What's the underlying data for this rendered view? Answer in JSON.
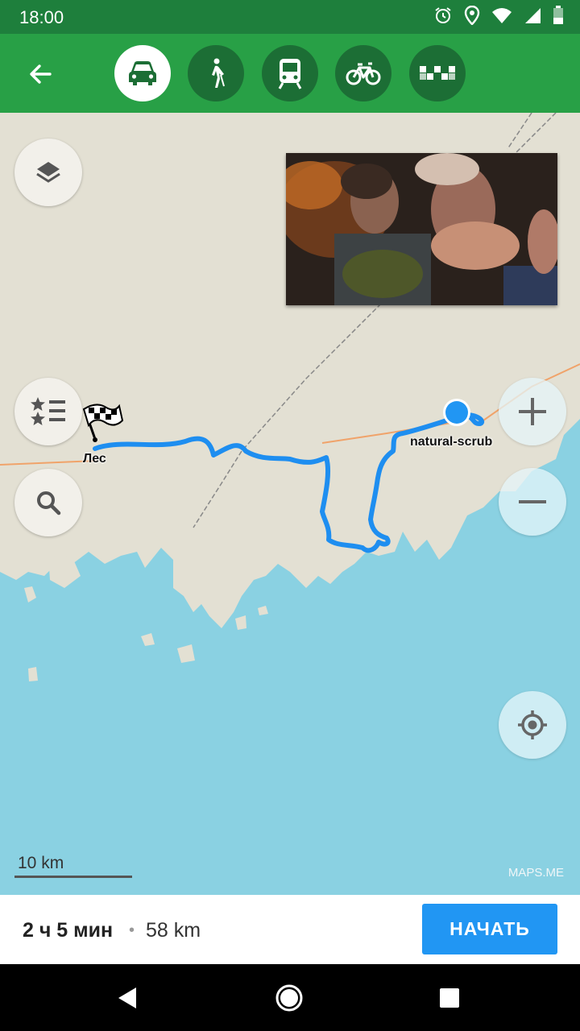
{
  "status_bar": {
    "time": "18:00",
    "icons": [
      "alarm-icon",
      "location-icon",
      "wifi-icon",
      "signal-icon",
      "battery-icon"
    ]
  },
  "toolbar": {
    "back_icon": "back-arrow-icon",
    "modes": [
      {
        "name": "car",
        "icon": "car-icon",
        "active": true
      },
      {
        "name": "walk",
        "icon": "pedestrian-icon",
        "active": false
      },
      {
        "name": "transit",
        "icon": "tram-icon",
        "active": false
      },
      {
        "name": "bike",
        "icon": "bicycle-icon",
        "active": false
      },
      {
        "name": "taxi",
        "icon": "taxi-icon",
        "active": false
      }
    ],
    "colors": {
      "bar": "#28a046",
      "status": "#1e7f3c",
      "button": "#1c6e35"
    }
  },
  "map": {
    "labels": {
      "destination": "Лес",
      "origin": "natural-scrub"
    },
    "scale_label": "10 km",
    "attribution": "MAPS.ME",
    "colors": {
      "land": "#e3e0d3",
      "water": "#8ad1e2",
      "route": "#1e8ef0",
      "road": "#f0a36a",
      "position": "#2196f3"
    }
  },
  "route_summary": {
    "duration": "2 ч 5 мин",
    "separator": "•",
    "distance": "58 km",
    "start_label": "НАЧАТЬ"
  }
}
